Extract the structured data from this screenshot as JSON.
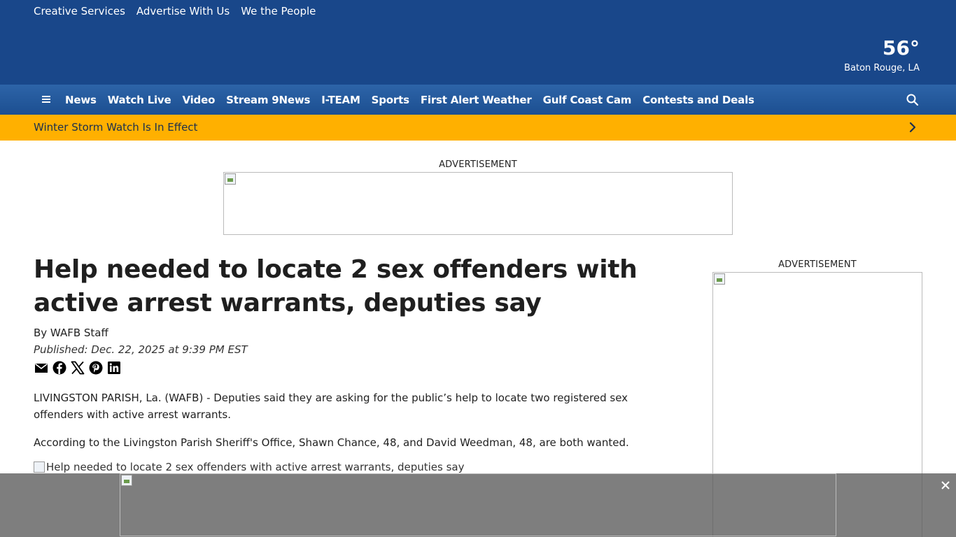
{
  "top_links": [
    "Creative Services",
    "Advertise With Us",
    "We the People"
  ],
  "weather": {
    "temperature": "56°",
    "location": "Baton Rouge, LA"
  },
  "nav": {
    "items": [
      "News",
      "Watch Live",
      "Video",
      "Stream 9News",
      "I-TEAM",
      "Sports",
      "First Alert Weather",
      "Gulf Coast Cam",
      "Contests and Deals"
    ]
  },
  "alert": {
    "text": "Winter Storm Watch Is In Effect"
  },
  "ads": {
    "label": "ADVERTISEMENT"
  },
  "article": {
    "headline": "Help needed to locate 2 sex offenders with active arrest warrants, deputies say",
    "byline": "By WAFB Staff",
    "published": "Published: Dec. 22, 2025 at 9:39 PM EST",
    "paragraphs": [
      "LIVINGSTON PARISH, La. (WAFB) - Deputies said they are asking for the public’s help to locate two registered sex offenders with active arrest warrants.",
      "According to the Livingston Parish Sheriff's Office, Shawn Chance, 48, and David Weedman, 48, are both wanted."
    ],
    "image_alt": "Help needed to locate 2 sex offenders with active arrest warrants, deputies say"
  },
  "share_icons": [
    "email-icon",
    "facebook-icon",
    "x-icon",
    "pinterest-icon",
    "linkedin-icon"
  ],
  "colors": {
    "header_bg": "#19478a",
    "nav_bg": "#2d64a8",
    "alert_bg": "#ffb000"
  }
}
